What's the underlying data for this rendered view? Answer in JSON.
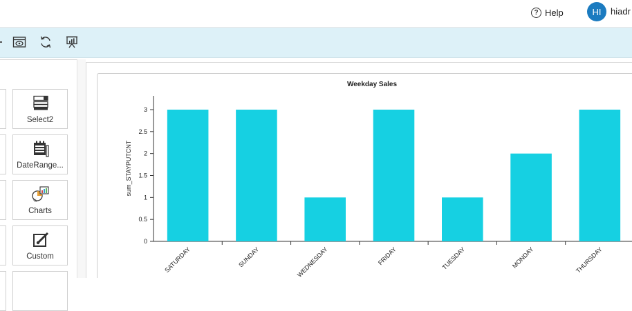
{
  "header": {
    "help_label": "Help",
    "help_icon": "question-circle-icon",
    "avatar_initials": "HI",
    "username": "hiadr"
  },
  "toolbar": {
    "tools": [
      {
        "name": "preview-icon"
      },
      {
        "name": "refresh-icon"
      },
      {
        "name": "presentation-chart-icon"
      }
    ]
  },
  "widgets": [
    {
      "label": "Select2",
      "icon": "select-list-icon"
    },
    {
      "label": "DateRange...",
      "icon": "date-range-icon"
    },
    {
      "label": "Charts",
      "icon": "charts-icon"
    },
    {
      "label": "Custom",
      "icon": "custom-edit-icon"
    }
  ],
  "chart_data": {
    "type": "bar",
    "title": "Weekday Sales",
    "xlabel": "",
    "ylabel": "sum_STAYPUTCNT",
    "categories": [
      "SATURDAY",
      "SUNDAY",
      "WEDNESDAY",
      "FRIDAY",
      "TUESDAY",
      "MONDAY",
      "THURSDAY"
    ],
    "values": [
      3,
      3,
      1,
      3,
      1,
      2,
      3
    ],
    "ylim": [
      0,
      3
    ],
    "yticks": [
      "0",
      "0.5",
      "1",
      "1.5",
      "2",
      "2.5",
      "3"
    ],
    "bar_color": "#16d0e2",
    "grid": false
  }
}
